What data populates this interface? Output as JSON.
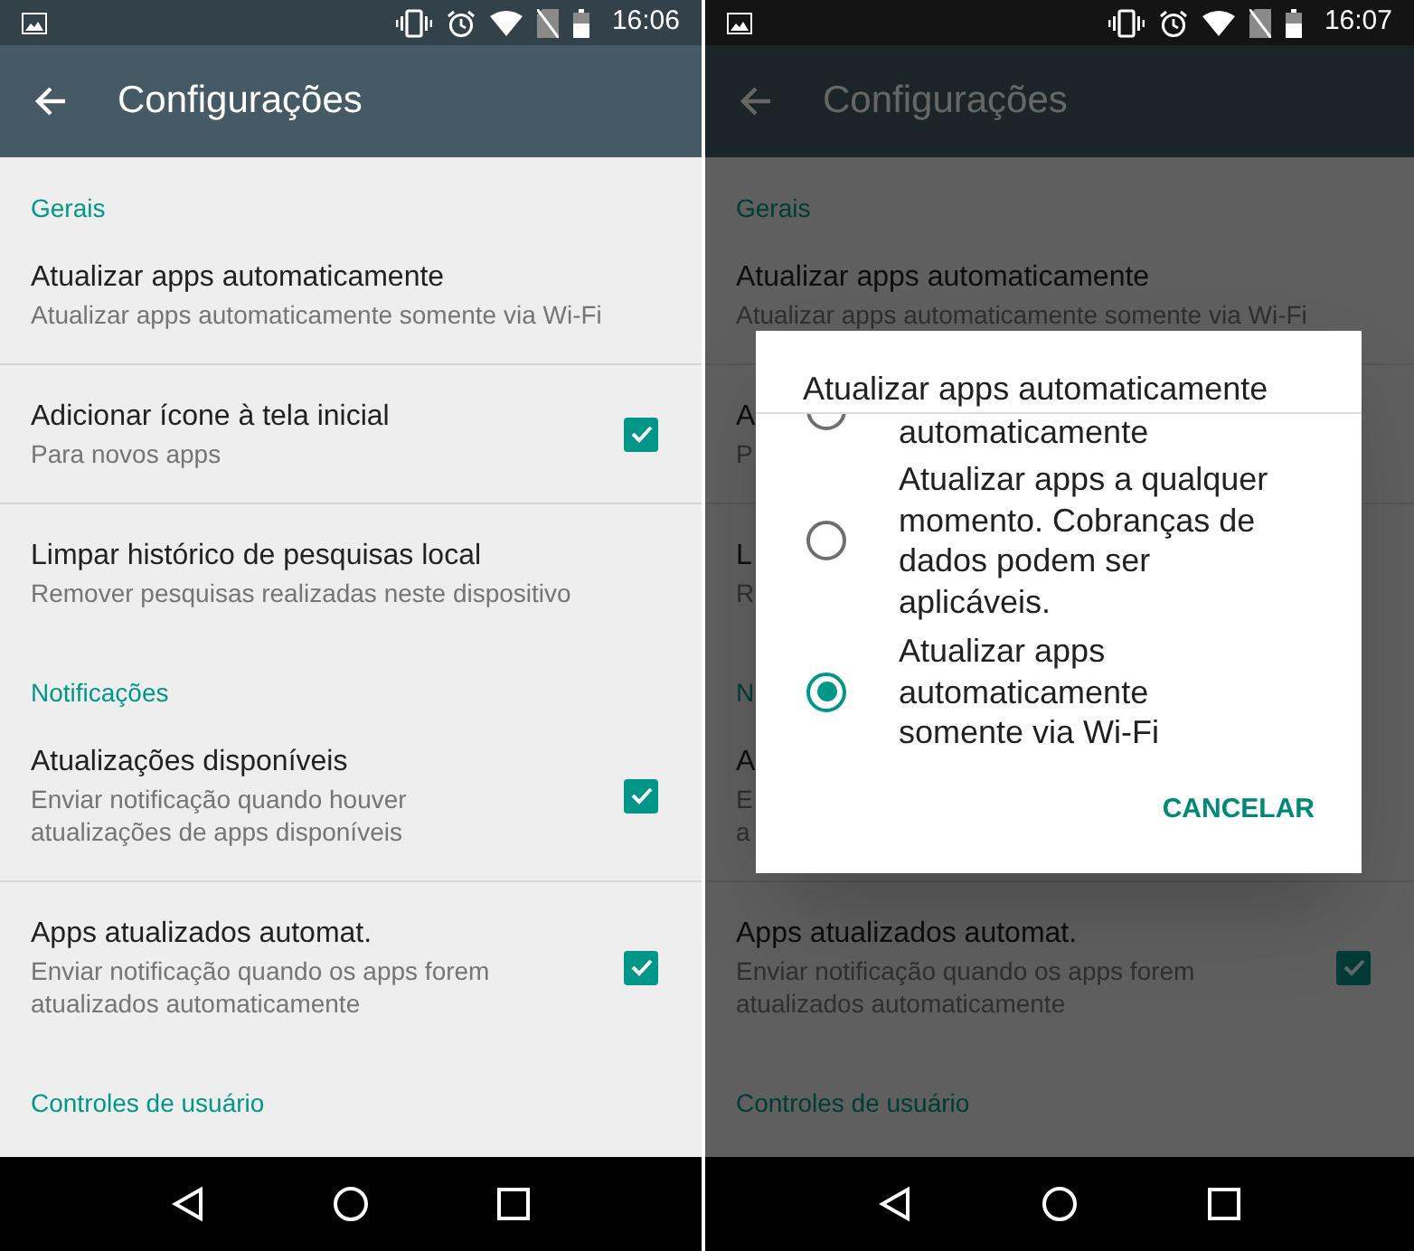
{
  "screens": [
    {
      "time": "16:06",
      "title": "Configurações",
      "dimmed": false,
      "content": [
        {
          "kind": "header",
          "text": "Gerais"
        },
        {
          "kind": "item",
          "title": "Atualizar apps automaticamente",
          "lines": [
            "Atualizar apps automaticamente somente via Wi-Fi"
          ]
        },
        {
          "kind": "item",
          "title": "Adicionar ícone à tela inicial",
          "lines": [
            "Para novos apps"
          ],
          "checked": true
        },
        {
          "kind": "item",
          "title": "Limpar histórico de pesquisas local",
          "lines": [
            "Remover pesquisas realizadas neste dispositivo"
          ]
        },
        {
          "kind": "header",
          "text": "Notificações"
        },
        {
          "kind": "item",
          "title": "Atualizações disponíveis",
          "lines": [
            "Enviar notificação quando houver",
            "atualizações de apps disponíveis"
          ],
          "checked": true
        },
        {
          "kind": "item",
          "title": "Apps atualizados automat.",
          "lines": [
            "Enviar notificação quando os apps forem",
            "atualizados automaticamente"
          ],
          "checked": true
        },
        {
          "kind": "header",
          "text": "Controles de usuário"
        }
      ]
    },
    {
      "time": "16:07",
      "title": "Configurações",
      "dimmed": true,
      "content": [
        {
          "kind": "header",
          "text": "Gerais"
        },
        {
          "kind": "item",
          "title": "Atualizar apps automaticamente",
          "lines": [
            "Atualizar apps automaticamente somente via Wi-Fi"
          ]
        },
        {
          "kind": "item",
          "title": "A",
          "lines": [
            "P"
          ]
        },
        {
          "kind": "item",
          "title": "L",
          "lines": [
            "R"
          ]
        },
        {
          "kind": "header",
          "text": "N"
        },
        {
          "kind": "item",
          "title": "A",
          "lines": [
            "E",
            "a"
          ]
        },
        {
          "kind": "item",
          "title": "Apps atualizados automat.",
          "lines": [
            "Enviar notificação quando os apps forem",
            "atualizados automaticamente"
          ],
          "checked": true
        },
        {
          "kind": "header",
          "text": "Controles de usuário"
        }
      ],
      "dialog": {
        "title": "Atualizar apps automaticamente",
        "options": [
          {
            "kind": "cut",
            "text": "automaticamente",
            "selected": false
          },
          {
            "kind": "full",
            "text": "Atualizar apps a qualquer momento. Cobranças de dados podem ser aplicáveis.",
            "selected": false
          },
          {
            "kind": "full",
            "text": "Atualizar apps automaticamente somente via Wi-Fi",
            "selected": true
          }
        ],
        "button": "CANCELAR"
      }
    }
  ]
}
